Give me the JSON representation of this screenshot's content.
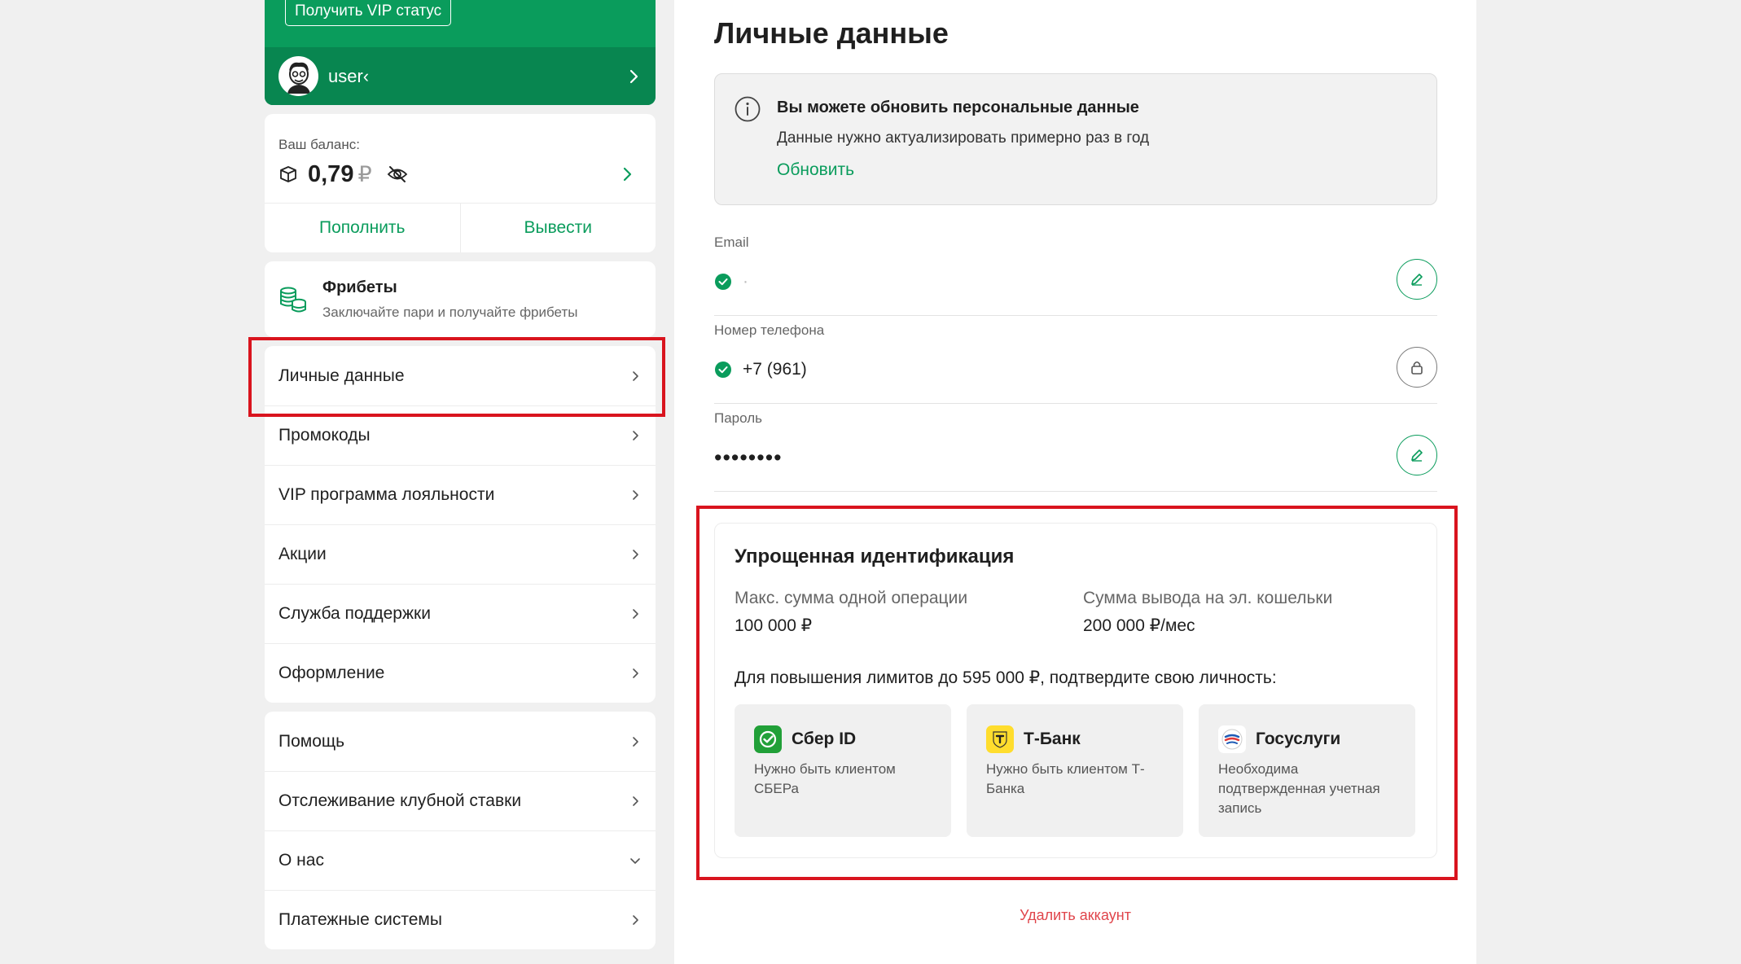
{
  "profile": {
    "vip_button": "Получить VIP статус",
    "username": "user‹"
  },
  "balance": {
    "label": "Ваш баланс:",
    "amount": "0,79",
    "currency": "₽",
    "deposit_label": "Пополнить",
    "withdraw_label": "Вывести"
  },
  "freebets": {
    "title": "Фрибеты",
    "subtitle": "Заключайте пари и получайте фрибеты"
  },
  "menu": {
    "group1": [
      {
        "label": "Личные данные",
        "name": "menu-item-personal-data"
      },
      {
        "label": "Промокоды",
        "name": "menu-item-promocodes"
      },
      {
        "label": "VIP программа лояльности",
        "name": "menu-item-vip-program"
      },
      {
        "label": "Акции",
        "name": "menu-item-promotions"
      },
      {
        "label": "Служба поддержки",
        "name": "menu-item-support"
      },
      {
        "label": "Оформление",
        "name": "menu-item-appearance"
      }
    ],
    "group2": [
      {
        "label": "Помощь",
        "name": "menu-item-help"
      },
      {
        "label": "Отслеживание клубной ставки",
        "name": "menu-item-club-bet-tracking"
      },
      {
        "label": "О нас",
        "name": "menu-item-about"
      },
      {
        "label": "Платежные системы",
        "name": "menu-item-payment-systems"
      }
    ]
  },
  "content": {
    "title": "Личные данные",
    "notice": {
      "title": "Вы можете обновить персональные данные",
      "text": "Данные нужно актуализировать примерно раз в год",
      "link": "Обновить"
    },
    "fields": {
      "email": {
        "label": "Email",
        "value": "·"
      },
      "phone": {
        "label": "Номер телефона",
        "value": "+7 (961)"
      },
      "password": {
        "label": "Пароль",
        "value": "••••••••"
      }
    },
    "identification": {
      "title": "Упрощенная идентификация",
      "max_operation_label": "Макс. сумма одной операции",
      "max_operation_value": "100 000 ₽",
      "wallet_label": "Сумма вывода на эл. кошельки",
      "wallet_value": "200 000 ₽/мес",
      "prompt": "Для повышения лимитов до 595 000 ₽, подтвердите свою личность:",
      "providers": {
        "sber": {
          "name": "Сбер ID",
          "desc": "Нужно быть клиентом СБЕРа"
        },
        "tbank": {
          "name": "Т-Банк",
          "desc": "Нужно быть клиентом Т-Банка"
        },
        "gosuslugi": {
          "name": "Госуслуги",
          "desc": "Необходима подтвержденная учетная запись"
        }
      }
    },
    "delete_account": "Удалить аккаунт"
  },
  "colors": {
    "brand_green": "#0a9c5c",
    "dark_green": "#088650",
    "highlight_red": "#d9141e",
    "danger_text": "#e0454b",
    "sber_green": "#21a038",
    "tbank_yellow": "#ffdd2d"
  },
  "icons": {
    "notice": "info-icon",
    "edit": "pencil-icon",
    "lock": "lock-icon",
    "verified": "check-circle-icon",
    "hide_balance": "eye-off-icon",
    "balance": "wallet-box-icon",
    "freebets": "coins-stack-icon"
  }
}
